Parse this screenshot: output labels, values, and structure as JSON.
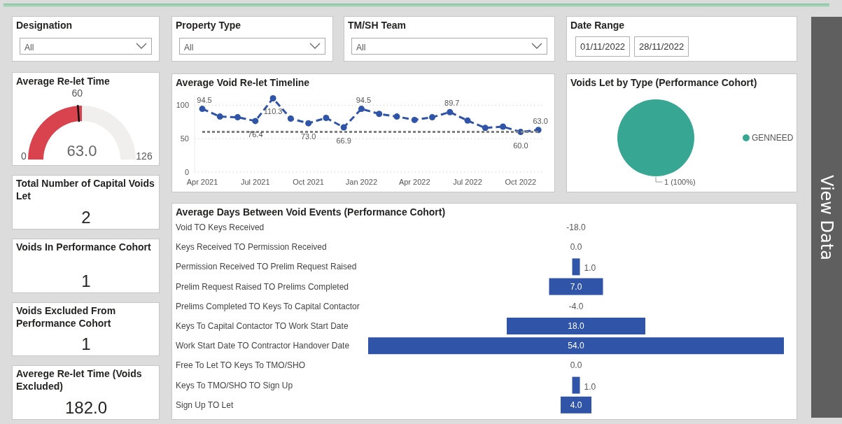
{
  "filters": [
    {
      "kind": "dropdown",
      "title": "Designation",
      "value": "All"
    },
    {
      "kind": "dropdown",
      "title": "Property Type",
      "value": "All"
    },
    {
      "kind": "dropdown",
      "title": "TM/SH Team",
      "value": "All"
    },
    {
      "kind": "date_range",
      "title": "Date Range",
      "start": "01/11/2022",
      "end": "28/11/2022"
    }
  ],
  "gauge": {
    "title": "Average Re-let Time",
    "value": "63.0",
    "min": "0",
    "max": "126",
    "target": "60",
    "level": 0.5
  },
  "kpis": [
    {
      "title": "Total Number of Capital Voids Let",
      "value": "2"
    },
    {
      "title": "Voids In Performance Cohort",
      "value": "1"
    },
    {
      "title": "Voids Excluded From Performance Cohort",
      "value": "1"
    },
    {
      "title": "Averege Re-let Time (Voids Excluded)",
      "value": "182.0"
    }
  ],
  "timeline": {
    "title": "Average Void Re-let Timeline",
    "chart_data": {
      "type": "line",
      "categories": [
        "Apr 2021",
        null,
        null,
        "Jul 2021",
        null,
        null,
        "Oct 2021",
        null,
        null,
        "Jan 2022",
        null,
        null,
        "Apr 2022",
        null,
        null,
        "Jul 2022",
        null,
        null,
        "Oct 2022",
        null
      ],
      "series": [
        {
          "color": "#2f54a8",
          "line_style": "dashed",
          "marker": "circle",
          "values": [
            94.5,
            83,
            82,
            76.4,
            110.3,
            80,
            73.0,
            81,
            66.9,
            94.5,
            87,
            83,
            78,
            82,
            89.7,
            77,
            66,
            68,
            60.0,
            63.0
          ]
        },
        {
          "color": "#808080",
          "line_style": "dotted",
          "values": [
            60,
            60,
            60,
            60,
            60,
            60,
            60,
            60,
            60,
            60,
            60,
            60,
            60,
            60,
            60,
            60,
            60,
            60,
            60,
            60
          ]
        }
      ],
      "ylim": [
        0,
        115
      ],
      "yticks": [
        0,
        50,
        100
      ],
      "value_labels": [
        "94.5",
        null,
        null,
        "76.4",
        "110.3",
        null,
        "73.0",
        null,
        "66.9",
        "94.5",
        null,
        null,
        null,
        null,
        "89.7",
        null,
        null,
        null,
        "60.0",
        "63.0"
      ]
    }
  },
  "pie_card": {
    "title": "Voids Let by Type (Performance Cohort)",
    "slices": [
      {
        "label": "GENNEED",
        "color": "#37a794",
        "value_label": "1 (100%)"
      }
    ]
  },
  "events": {
    "title": "Average Days Between Void Events (Performance Cohort)",
    "rows": [
      {
        "label": "Void TO Keys Received",
        "value": "-18.0"
      },
      {
        "label": "Keys Received TO Permission Received",
        "value": "0.0"
      },
      {
        "label": "Permission Received TO Prelim Request Raised",
        "value": "1.0"
      },
      {
        "label": "Prelim Request Raised TO Prelims Completed",
        "value": "7.0"
      },
      {
        "label": "Prelims Completed TO Keys To Capital Contactor",
        "value": "-4.0"
      },
      {
        "label": "Keys To Capital Contactor TO Work Start Date",
        "value": "18.0"
      },
      {
        "label": "Work Start Date TO Contractor Handover Date",
        "value": "54.0"
      },
      {
        "label": "Free To Let TO Keys To TMO/SHO",
        "value": "0.0"
      },
      {
        "label": "Keys To TMO/SHO TO Sign Up",
        "value": "1.0"
      },
      {
        "label": "Sign Up TO Let",
        "value": "4.0"
      }
    ]
  },
  "view_button": "View Data"
}
